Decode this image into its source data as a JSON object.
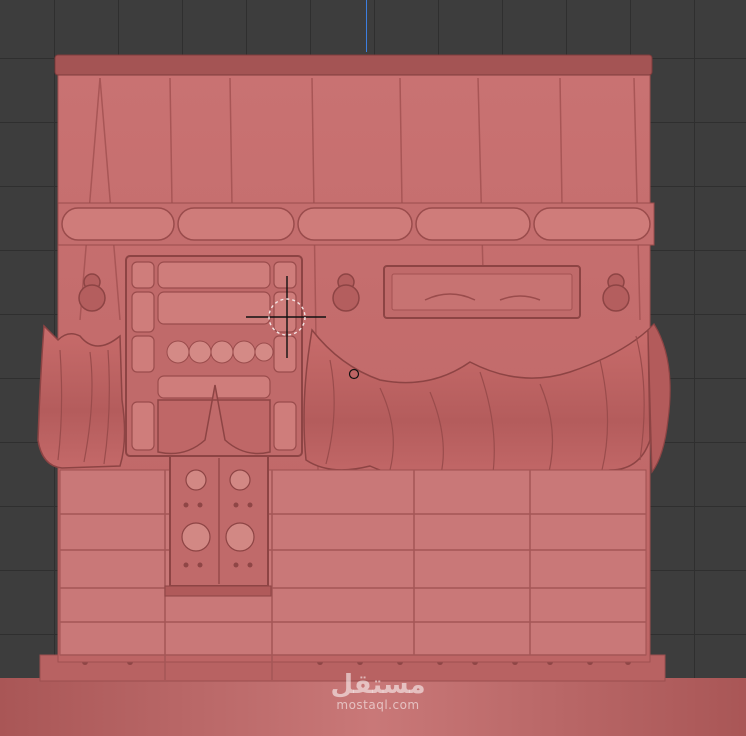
{
  "viewport": {
    "background": "#3d3d3d",
    "grid_color": "#2f2f2f",
    "axis_color": "#3d7fe0"
  },
  "model": {
    "name": "",
    "material_color": "#c9706f",
    "shadow_color": "#9d4f4f",
    "highlight_color": "#d9908c"
  },
  "cursor": {
    "icon": "crosshair-brush-icon"
  },
  "watermark": {
    "arabic": "مستقل",
    "latin": "mostaql.com"
  }
}
